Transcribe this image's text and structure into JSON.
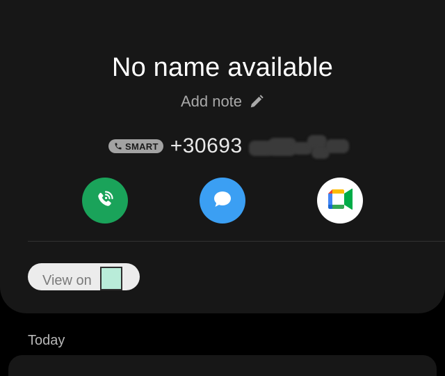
{
  "contact": {
    "name": "No name available",
    "add_note_label": "Add note",
    "badge_label": "SMART",
    "phone_number": "+30693"
  },
  "actions": [
    {
      "id": "call",
      "icon": "wifi-call-icon",
      "color": "#1aa35a"
    },
    {
      "id": "message",
      "icon": "chat-bubble-icon",
      "color": "#3b9ff3"
    },
    {
      "id": "video",
      "icon": "google-meet-icon",
      "color": "#ffffff"
    }
  ],
  "view_on": {
    "label": "View on"
  },
  "history": {
    "section_label": "Today"
  },
  "colors": {
    "background": "#000000",
    "card": "#171717",
    "text_primary": "#ffffff",
    "text_secondary": "#a9a9a9"
  }
}
